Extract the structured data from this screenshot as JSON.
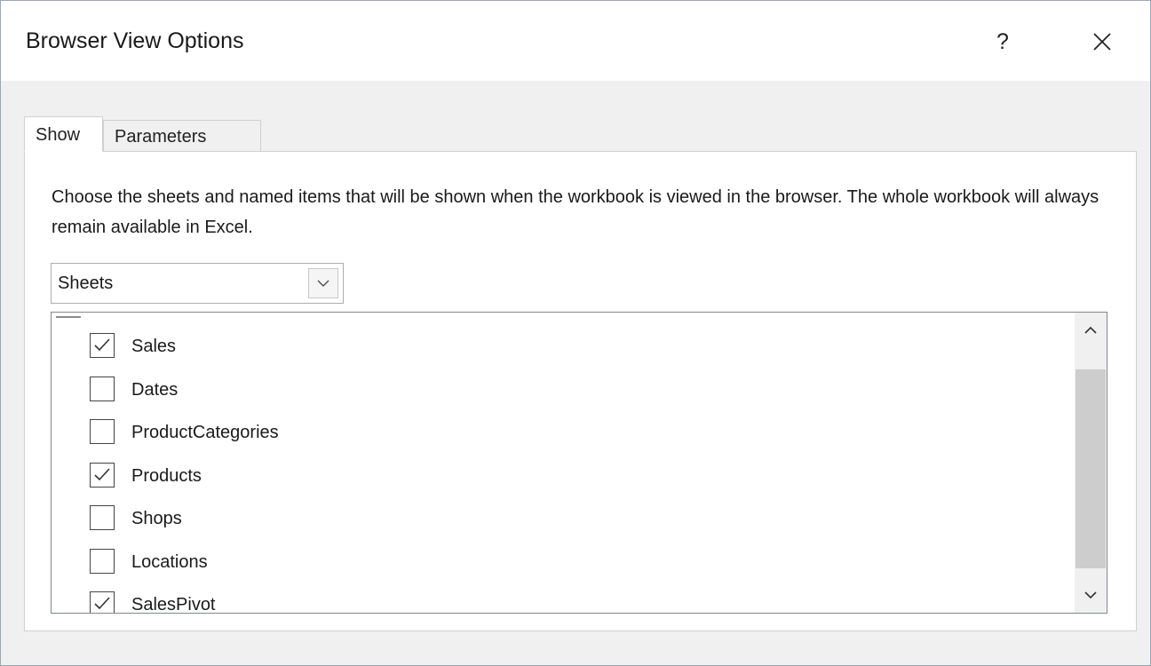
{
  "dialog": {
    "title": "Browser View Options",
    "help_label": "?",
    "close_icon": "close-icon"
  },
  "tabs": [
    {
      "label": "Show",
      "selected": true
    },
    {
      "label": "Parameters",
      "selected": false
    }
  ],
  "show_tab": {
    "description": "Choose the sheets and named items that will be shown when the workbook is viewed in the browser. The whole workbook will always remain available in Excel.",
    "dropdown": {
      "selected": "Sheets",
      "arrow_icon": "chevron-down-icon"
    },
    "items": [
      {
        "label": "Sales",
        "checked": true
      },
      {
        "label": "Dates",
        "checked": false
      },
      {
        "label": "ProductCategories",
        "checked": false
      },
      {
        "label": "Products",
        "checked": true
      },
      {
        "label": "Shops",
        "checked": false
      },
      {
        "label": "Locations",
        "checked": false
      },
      {
        "label": "SalesPivot",
        "checked": true
      }
    ],
    "scrollbar": {
      "up_icon": "chevron-up-icon",
      "down_icon": "chevron-down-icon"
    }
  },
  "colors": {
    "window_bg": "#f0f0f0",
    "panel_bg": "#ffffff",
    "scroll_thumb": "#cdcdcd",
    "border": "#828790"
  }
}
